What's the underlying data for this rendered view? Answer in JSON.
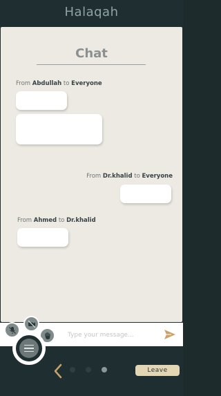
{
  "app": {
    "title": "Halaqah"
  },
  "chat": {
    "heading": "Chat",
    "messages": [
      {
        "from_label": "From",
        "sender": "Abdullah",
        "to_label": "to",
        "recipient": "Everyone"
      },
      {
        "from_label": "From",
        "sender": "Dr.khalid",
        "to_label": "to",
        "recipient": "Everyone"
      },
      {
        "from_label": "From",
        "sender": "Ahmed",
        "to_label": "to",
        "recipient": "Dr.khalid"
      }
    ]
  },
  "composer": {
    "placeholder": "Type your message...",
    "value": "",
    "send_icon": "send-arrow-icon"
  },
  "controls": {
    "icons": [
      "mic-off-icon",
      "camera-off-icon",
      "raise-hand-icon",
      "menu-icon"
    ]
  },
  "footer": {
    "leave_label": "Leave",
    "page_count": 3,
    "active_page": 3
  },
  "colors": {
    "background": "#1f2f31",
    "panel": "#edeae3",
    "accent": "#c9a36a",
    "leave_button": "#e2d6b3"
  }
}
